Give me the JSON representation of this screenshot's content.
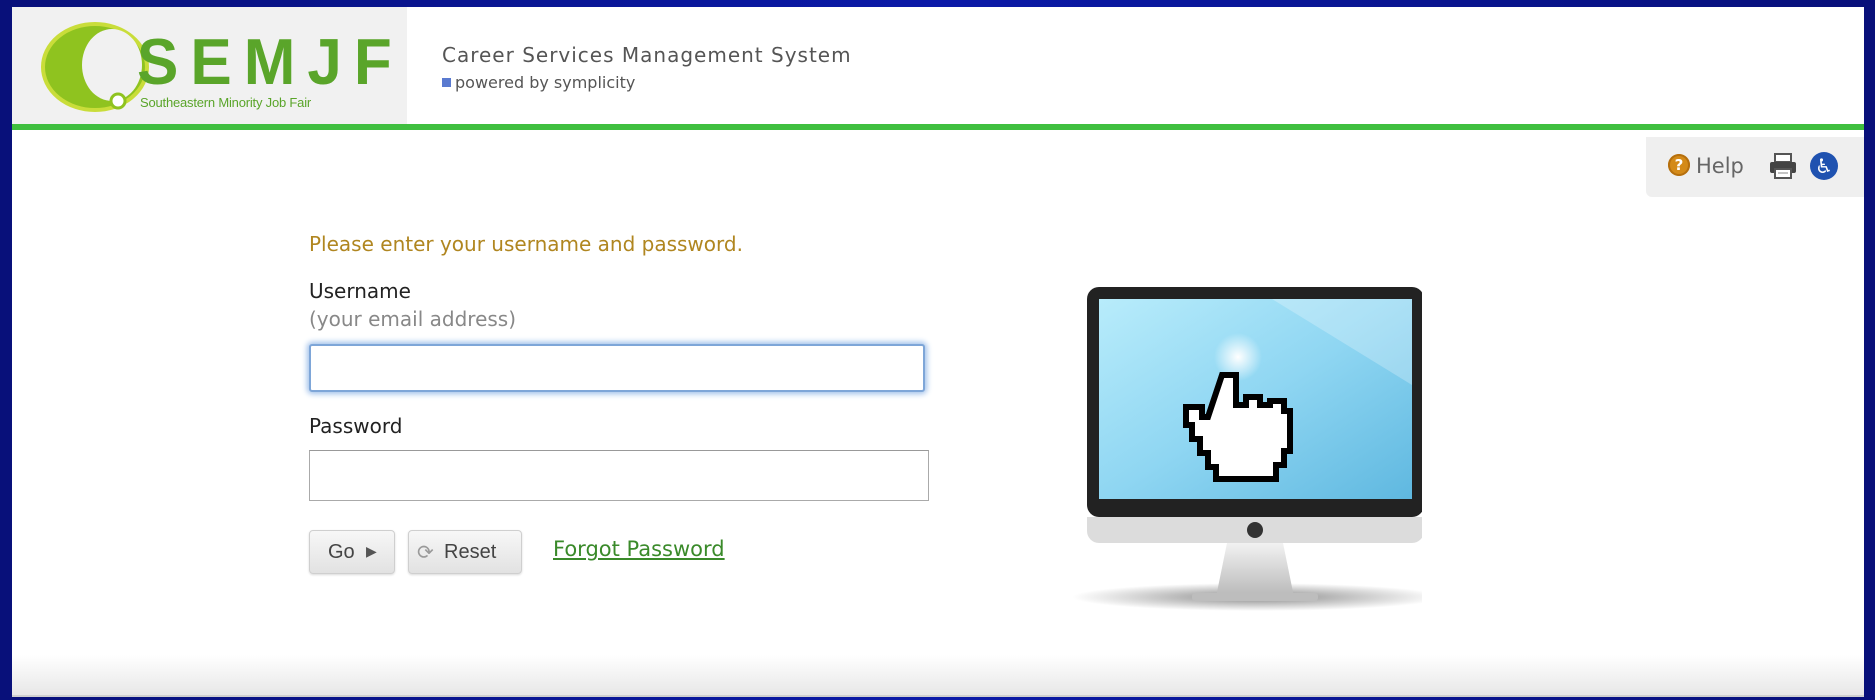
{
  "header": {
    "logo_text": "SEMJF",
    "logo_subtitle": "Southeastern Minority Job Fair",
    "title": "Career Services Management System",
    "powered_by": "powered by symplicity"
  },
  "utility": {
    "help_label": "Help",
    "icons": [
      "help-icon",
      "print-icon",
      "accessibility-icon"
    ]
  },
  "login": {
    "prompt": "Please enter your username and password.",
    "username_label": "Username",
    "username_hint": "(your email address)",
    "username_value": "",
    "password_label": "Password",
    "password_value": "",
    "go_label": "Go",
    "reset_label": "Reset",
    "forgot_label": "Forgot Password"
  },
  "colors": {
    "brand_green": "#5aa52a",
    "header_rule": "#3fbf3f",
    "prompt_text": "#b08620",
    "link": "#3a8a2a",
    "slide_background": "#0b1aa8"
  }
}
